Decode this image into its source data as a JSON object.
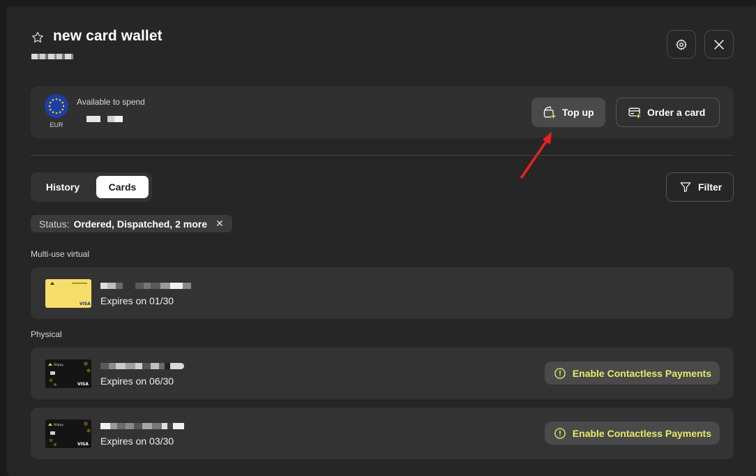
{
  "header": {
    "title": "new card wallet",
    "settings_icon": "gear-icon",
    "close_icon": "close-icon"
  },
  "balance": {
    "currency": "EUR",
    "available_label": "Available to spend",
    "topup_label": "Top up",
    "order_label": "Order a card"
  },
  "tabs": {
    "history": "History",
    "cards": "Cards",
    "active": "Cards"
  },
  "filter": {
    "label": "Filter"
  },
  "status_filter": {
    "label": "Status:",
    "value": "Ordered, Dispatched, 2 more"
  },
  "sections": {
    "virtual_label": "Multi-use virtual",
    "physical_label": "Physical"
  },
  "cards": {
    "virtual": [
      {
        "expires": "Expires on 01/30"
      }
    ],
    "physical": [
      {
        "expires": "Expires on 06/30",
        "action": "Enable Contactless Payments"
      },
      {
        "expires": "Expires on 03/30",
        "action": "Enable Contactless Payments"
      }
    ]
  },
  "colors": {
    "accent": "#e4ec6a",
    "arrow": "#e8231f",
    "virtual_card": "#f7de6b",
    "background": "#262626"
  }
}
